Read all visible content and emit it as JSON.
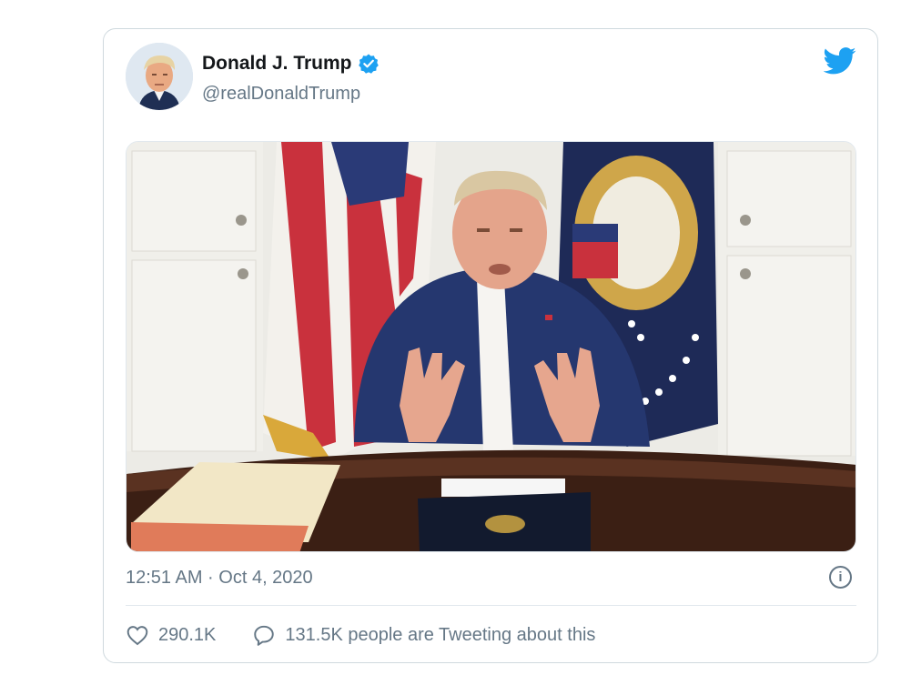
{
  "tweet": {
    "author_name": "Donald J. Trump",
    "handle": "@realDonaldTrump",
    "timestamp": "12:51 AM · Oct 4, 2020",
    "info_icon": "i",
    "likes": "290.1K",
    "replies_text": "131.5K people are Tweeting about this"
  },
  "icons": {
    "brand": "twitter-bird-icon",
    "verified": "verified-badge-icon",
    "like": "heart-icon",
    "reply": "speech-bubble-icon",
    "info": "info-icon"
  },
  "colors": {
    "brand_blue": "#1da1f2",
    "text_secondary": "#657786",
    "border": "#cfd9de"
  }
}
